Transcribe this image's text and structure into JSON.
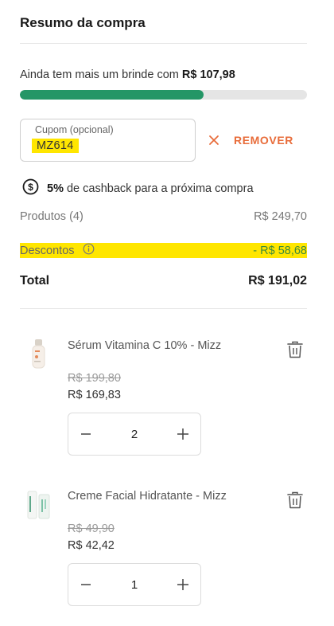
{
  "summary": {
    "title": "Resumo da compra",
    "gift_prefix": "Ainda tem mais um brinde com",
    "gift_amount": "R$ 107,98",
    "gift_progress": 0.64,
    "coupon": {
      "label": "Cupom (opcional)",
      "value": "MZ614",
      "remove_label": "REMOVER"
    },
    "cashback": {
      "percent": "5%",
      "text": "de cashback para a próxima compra"
    },
    "products_label": "Produtos (4)",
    "products_value": "R$ 249,70",
    "discounts_label": "Descontos",
    "discounts_value": "- R$ 58,68",
    "total_label": "Total",
    "total_value": "R$ 191,02"
  },
  "items": [
    {
      "name": "Sérum Vitamina C 10% - Mizz",
      "old_price": "R$ 199,80",
      "new_price": "R$ 169,83",
      "quantity": "2"
    },
    {
      "name": "Creme Facial Hidratante - Mizz",
      "old_price": "R$ 49,90",
      "new_price": "R$ 42,42",
      "quantity": "1"
    }
  ],
  "colors": {
    "progress": "#249666",
    "remove": "#e86c3a",
    "highlight": "#ffe600",
    "discount_value": "#3d8a3a"
  },
  "icons": {
    "remove": "close-icon",
    "cashback": "dollar-circle-icon",
    "info": "info-icon",
    "trash": "trash-icon",
    "minus": "minus-icon",
    "plus": "plus-icon"
  }
}
